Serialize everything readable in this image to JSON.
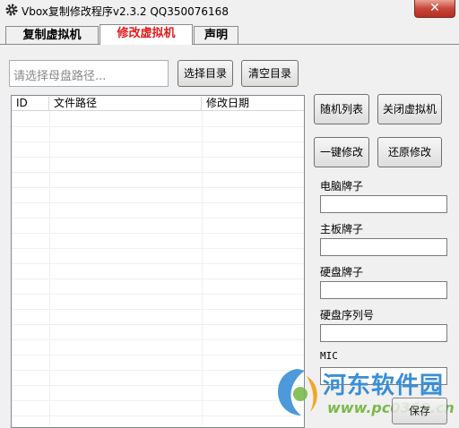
{
  "window": {
    "title": "Vbox复制修改程序v2.3.2  QQ350076168",
    "close_label": "✕"
  },
  "tabs": [
    {
      "label": "复制虚拟机",
      "active": false
    },
    {
      "label": "修改虚拟机",
      "active": true
    },
    {
      "label": "声明",
      "active": false
    }
  ],
  "toolbar": {
    "path_placeholder": "请选择母盘路径...",
    "select_dir_label": "选择目录",
    "clear_dir_label": "清空目录"
  },
  "table": {
    "columns": [
      "ID",
      "文件路径",
      "修改日期"
    ],
    "rows": []
  },
  "actions": {
    "random_list_label": "随机列表",
    "close_vm_label": "关闭虚拟机",
    "one_click_modify_label": "一键修改",
    "restore_modify_label": "还原修改",
    "save_label": "保存"
  },
  "fields": {
    "computer_brand_label": "电脑牌子",
    "motherboard_brand_label": "主板牌子",
    "disk_brand_label": "硬盘牌子",
    "disk_serial_label": "硬盘序列号",
    "mic_label": "MIC"
  },
  "watermark": {
    "brand": "河东软件园",
    "url": "www.pc0359.cn"
  },
  "colors": {
    "active_tab_text": "#e21b1b",
    "close_button": "#c8463a",
    "watermark_blue": "#3a8ed6",
    "watermark_green": "#7cb94c"
  },
  "icons": {
    "app": "gear-icon",
    "close": "close-icon"
  }
}
